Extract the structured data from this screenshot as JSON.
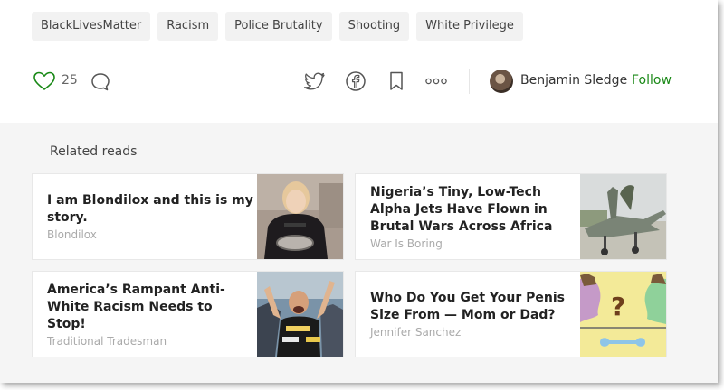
{
  "tags": [
    "BlackLivesMatter",
    "Racism",
    "Police Brutality",
    "Shooting",
    "White Privilege"
  ],
  "actions": {
    "clap_count": "25"
  },
  "author": {
    "name": "Benjamin Sledge",
    "separator": "·",
    "follow_label": "Follow"
  },
  "related": {
    "title": "Related reads",
    "cards": [
      {
        "title": "I am Blondilox and this is my story.",
        "source": "Blondilox"
      },
      {
        "title": "Nigeria’s Tiny, Low-Tech Alpha Jets Have Flown in Brutal Wars Across Africa",
        "source": "War Is Boring"
      },
      {
        "title": "America’s Rampant Anti-White Racism Needs to Stop!",
        "source": "Traditional Tradesman"
      },
      {
        "title": "Who Do You Get Your Penis Size From — Mom or Dad?",
        "source": "Jennifer Sanchez"
      }
    ]
  },
  "colors": {
    "accent_green": "#1a8917",
    "tag_bg": "#f2f2f2",
    "section_bg": "#f5f5f5"
  },
  "icons": [
    "heart-icon",
    "comment-icon",
    "twitter-icon",
    "facebook-icon",
    "bookmark-icon",
    "more-icon"
  ]
}
